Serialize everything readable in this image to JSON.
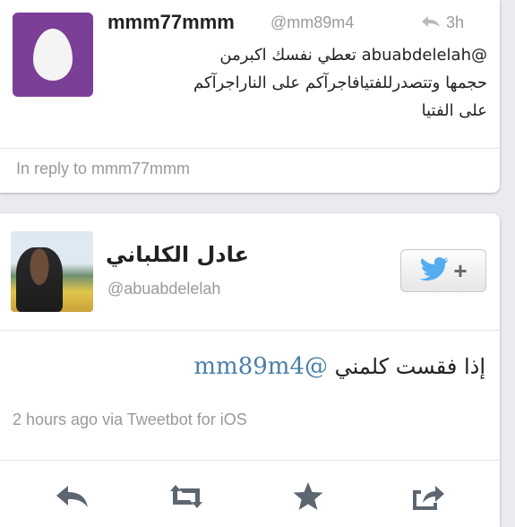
{
  "reply_tweet": {
    "name": "mmm77mmm",
    "handle": "@mm89m4",
    "time": "3h",
    "text_line1": "@abuabdelelah تعطي نفسك اكبرمن",
    "text_line2": "حجمها وتتصدرللفتيافاجرآكم على الناراجرآكم",
    "text_line3": "على الفتيا",
    "in_reply_to": "In reply to mmm77mmm"
  },
  "main_tweet": {
    "name": "عادل الكلباني",
    "handle": "@abuabdelelah",
    "mention": "@mm89m4",
    "text": "إذا فقست كلمني",
    "meta": "2 hours ago via Tweetbot for iOS"
  },
  "icons": {
    "reply_arrow": "reply-arrow-icon",
    "follow": "twitter-bird-icon",
    "retweet": "retweet-icon",
    "favorite": "star-icon",
    "share": "share-icon"
  },
  "colors": {
    "egg_avatar": "#7b3f97",
    "mention_link": "#4a7fa8",
    "bird": "#55acee"
  }
}
